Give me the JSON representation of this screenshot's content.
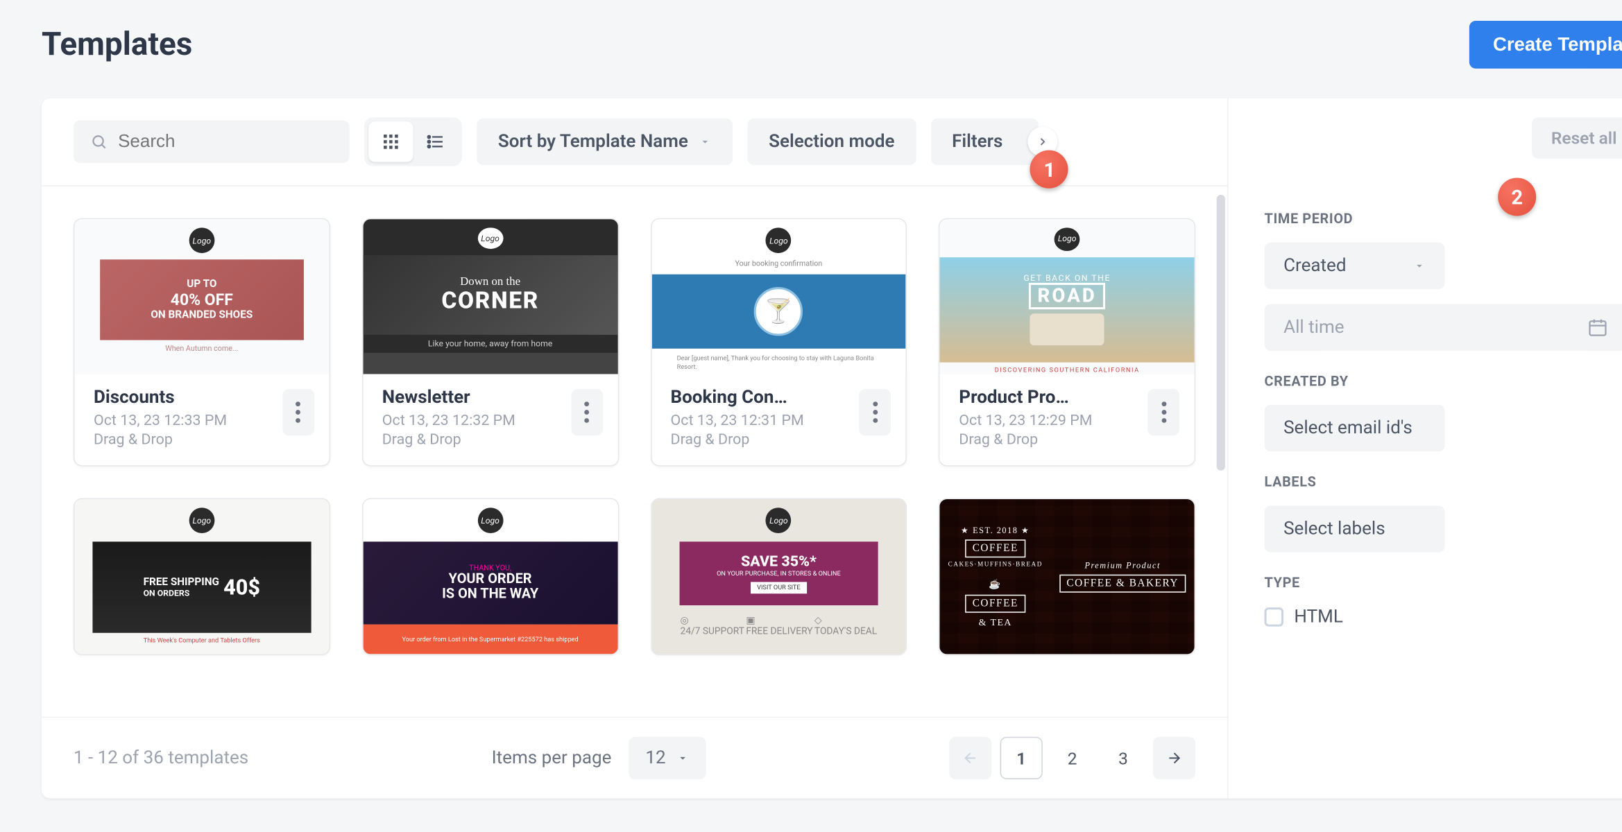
{
  "header": {
    "title": "Templates",
    "create_button": "Create Template"
  },
  "toolbar": {
    "search_placeholder": "Search",
    "sort_label": "Sort by Template Name",
    "selection_mode": "Selection mode",
    "filters": "Filters"
  },
  "annotations": {
    "marker1": "1",
    "marker2": "2"
  },
  "templates": [
    {
      "name": "Discounts",
      "date": "Oct 13, 23 12:33 PM",
      "type": "Drag & Drop",
      "thumb": {
        "kind": "th1",
        "line1": "UP TO",
        "line2": "40% OFF",
        "line3": "ON BRANDED SHOES",
        "caption": "When Autumn come..."
      }
    },
    {
      "name": "Newsletter",
      "date": "Oct 13, 23 12:32 PM",
      "type": "Drag & Drop",
      "thumb": {
        "kind": "th2",
        "line1": "Down on the",
        "line2": "CORNER",
        "caption": "Like your home, away from home"
      }
    },
    {
      "name": "Booking Con…",
      "date": "Oct 13, 23 12:31 PM",
      "type": "Drag & Drop",
      "thumb": {
        "kind": "th3",
        "bar": "Your booking confirmation",
        "glyph": "🍸",
        "txt": "Dear [guest name], Thank you for choosing to stay with Laguna Bonita Resort."
      }
    },
    {
      "name": "Product Pro…",
      "date": "Oct 13, 23 12:29 PM",
      "type": "Drag & Drop",
      "thumb": {
        "kind": "th4",
        "line1": "GET BACK ON THE",
        "line2": "ROAD",
        "caption": "DISCOVERING SOUTHERN CALIFORNIA"
      }
    },
    {
      "name": "",
      "date": "",
      "type": "",
      "thumb": {
        "kind": "th5",
        "line1": "FREE SHIPPING",
        "line2": "ON ORDERS",
        "num": "40$",
        "caption": "This Week's Computer and Tablets Offers"
      }
    },
    {
      "name": "",
      "date": "",
      "type": "",
      "thumb": {
        "kind": "th6",
        "line1": "THANK YOU,",
        "line2": "YOUR ORDER",
        "line3": "IS ON THE WAY",
        "bar": "Your order from Lost in the Supermarket #225572 has shipped"
      }
    },
    {
      "name": "",
      "date": "",
      "type": "",
      "thumb": {
        "kind": "th7",
        "line1": "SAVE 35%*",
        "line2": "ON YOUR PURCHASE, IN STORES & ONLINE",
        "btn": "VISIT OUR SITE",
        "i1": "24/7 SUPPORT",
        "i2": "FREE DELIVERY",
        "i3": "TODAY'S DEAL"
      }
    },
    {
      "name": "",
      "date": "",
      "type": "",
      "thumb": {
        "kind": "th8",
        "c1a": "COFFEE",
        "c1b": "CAKES·MUFFINS·BREAD",
        "c1c": "COFFEE",
        "c1d": "& TEA",
        "c2a": "Premium Product",
        "c2b": "COFFEE & BAKERY"
      }
    }
  ],
  "footer": {
    "count_text": "1 - 12 of 36 templates",
    "items_per_page_label": "Items per page",
    "items_per_page_value": "12",
    "pages": [
      "1",
      "2",
      "3"
    ],
    "active_page": "1"
  },
  "filters_panel": {
    "reset": "Reset all",
    "time_period_label": "TIME PERIOD",
    "time_period_field": "Created",
    "time_period_range": "All time",
    "created_by_label": "CREATED BY",
    "created_by_placeholder": "Select email id's",
    "labels_label": "LABELS",
    "labels_placeholder": "Select labels",
    "type_label": "TYPE",
    "type_option_html": "HTML"
  }
}
